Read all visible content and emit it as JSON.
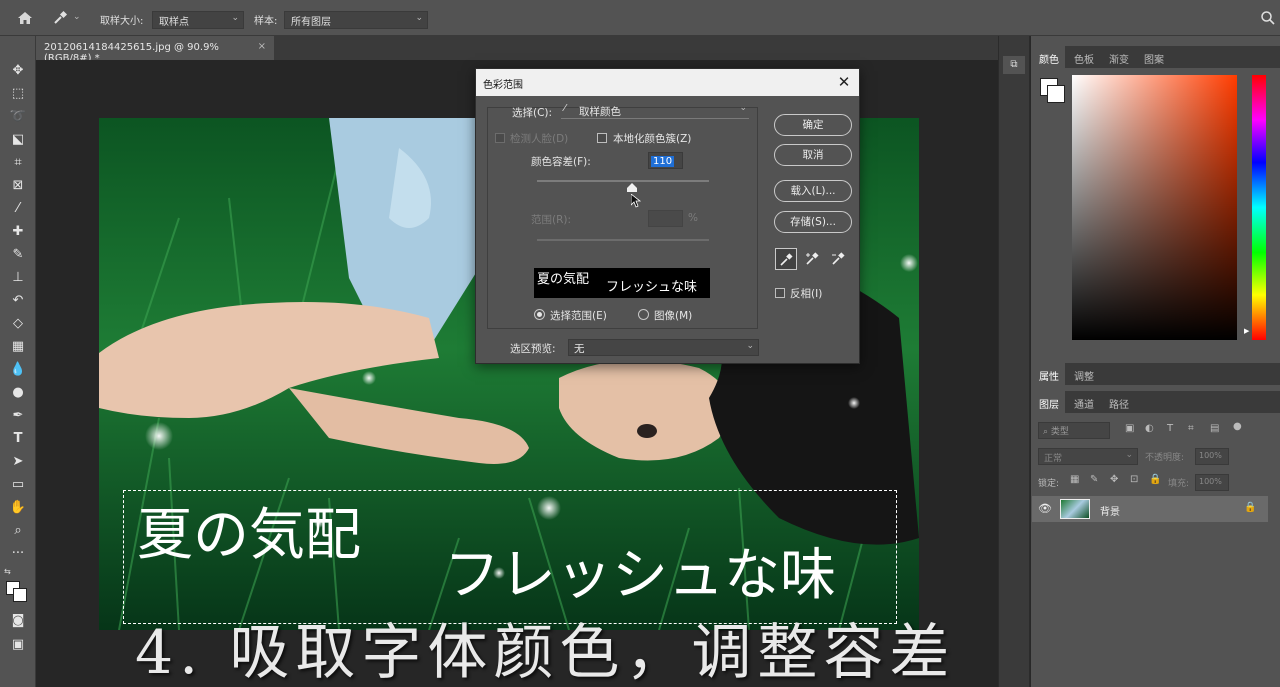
{
  "optionbar": {
    "sample_size_label": "取样大小:",
    "sample_size_value": "取样点",
    "sample_label": "样本:",
    "sample_value": "所有图层"
  },
  "document": {
    "tab_title": "20120614184425615.jpg @ 90.9%(RGB/8#) *",
    "image_text_1": "夏の気配",
    "image_text_2": "フレッシュな味"
  },
  "color_panel": {
    "tabs": [
      "颜色",
      "色板",
      "渐变",
      "图案"
    ]
  },
  "properties_panel": {
    "tabs": [
      "属性",
      "调整"
    ]
  },
  "layers_panel": {
    "tabs": [
      "图层",
      "通道",
      "路径"
    ],
    "filter_placeholder": "类型",
    "blend_mode": "正常",
    "opacity_label": "不透明度:",
    "opacity_value": "100%",
    "lock_label": "锁定:",
    "fill_label": "填充:",
    "fill_value": "100%",
    "layers": [
      {
        "name": "背景"
      }
    ]
  },
  "dialog": {
    "title": "色彩范围",
    "select_label": "选择(C):",
    "select_value": "取样颜色",
    "detect_faces_label": "检测人脸(D)",
    "localized_label": "本地化颜色簇(Z)",
    "fuzziness_label": "颜色容差(F):",
    "fuzziness_value": "110",
    "range_label": "范围(R):",
    "range_unit": "%",
    "preview_text_1": "夏の気配",
    "preview_text_2": "フレッシュな味",
    "radio_selection": "选择范围(E)",
    "radio_image": "图像(M)",
    "selection_preview_label": "选区预览:",
    "selection_preview_value": "无",
    "ok_label": "确定",
    "cancel_label": "取消",
    "load_label": "载入(L)...",
    "save_label": "存储(S)...",
    "invert_label": "反相(I)",
    "fuzziness_fraction": 0.55
  },
  "caption": "4. 吸取字体颜色，调整容差",
  "colors": {
    "panel_bg": "#535353",
    "dark_bg": "#3a3a3a",
    "accent_highlight": "#1f6fd6"
  }
}
